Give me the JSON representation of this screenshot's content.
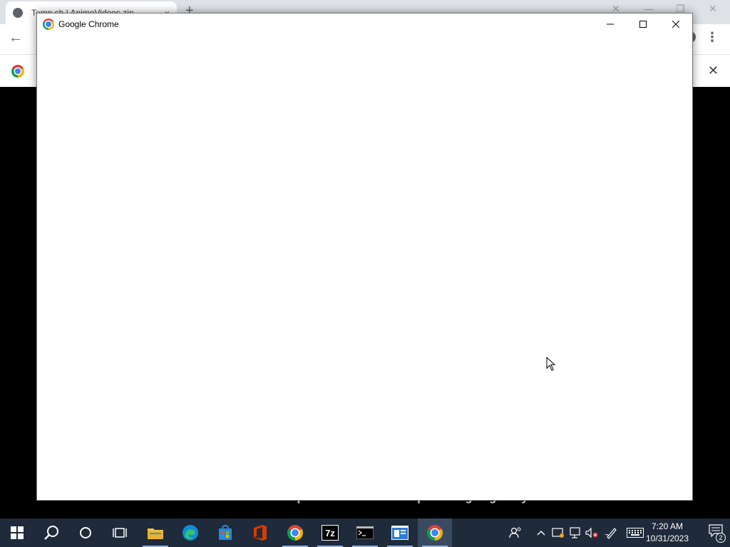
{
  "background_browser": {
    "tab_title": "Temp.sh | AnimeVideos.zip",
    "tab_close": "×",
    "new_tab": "+",
    "back": "←",
    "menu": "⋮",
    "infobar_close": "✕",
    "video_caption": "contact: tempenationalvisitpostingragency"
  },
  "window": {
    "title": "Google Chrome"
  },
  "taskbar": {
    "items": [
      {
        "name": "start-button",
        "icon": "windows-logo-icon"
      },
      {
        "name": "search-button",
        "icon": "search-icon"
      },
      {
        "name": "cortana-button",
        "icon": "cortana-circle-icon"
      },
      {
        "name": "task-view-button",
        "icon": "task-view-icon"
      },
      {
        "name": "file-explorer",
        "icon": "folder-icon"
      },
      {
        "name": "edge",
        "icon": "edge-icon"
      },
      {
        "name": "store",
        "icon": "store-icon"
      },
      {
        "name": "office",
        "icon": "office-icon"
      },
      {
        "name": "chrome",
        "icon": "chrome-icon"
      },
      {
        "name": "7zip",
        "icon": "7zip-icon",
        "label": "7z"
      },
      {
        "name": "terminal",
        "icon": "terminal-icon"
      },
      {
        "name": "notepad-window",
        "icon": "window-icon"
      },
      {
        "name": "chrome-active",
        "icon": "chrome-icon"
      }
    ],
    "clock": {
      "time": "7:20 AM",
      "date": "10/31/2023"
    },
    "notification_count": "2"
  },
  "colors": {
    "taskbar_bg": "#1f2a3a",
    "window_bg": "#ffffff",
    "desktop_bg": "#000000"
  }
}
